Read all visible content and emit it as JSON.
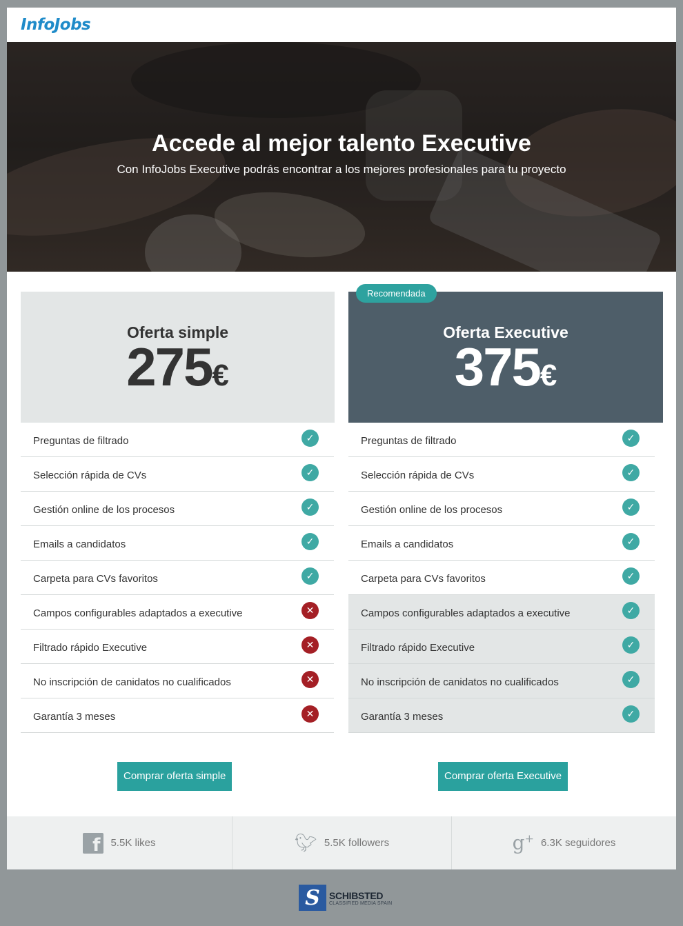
{
  "header": {
    "logo_text": "InfoJobs"
  },
  "hero": {
    "title": "Accede al mejor talento Executive",
    "subtitle": "Con InfoJobs Executive podrás encontrar a los  mejores profesionales para tu proyecto"
  },
  "plans": [
    {
      "name": "Oferta simple",
      "price": "275",
      "currency": "€",
      "button_label": "Comprar oferta simple",
      "features": [
        {
          "label": "Preguntas de filtrado",
          "included": true,
          "icon": "check-icon"
        },
        {
          "label": "Selección rápida de CVs",
          "included": true,
          "icon": "check-icon"
        },
        {
          "label": "Gestión online de los procesos",
          "included": true,
          "icon": "check-icon"
        },
        {
          "label": "Emails a candidatos",
          "included": true,
          "icon": "check-icon"
        },
        {
          "label": "Carpeta para CVs favoritos",
          "included": true,
          "icon": "check-icon"
        },
        {
          "label": "Campos configurables adaptados a executive",
          "included": false,
          "icon": "cross-icon"
        },
        {
          "label": "Filtrado rápido Executive",
          "included": false,
          "icon": "cross-icon"
        },
        {
          "label": "No inscripción de canidatos no cualificados",
          "included": false,
          "icon": "cross-icon"
        },
        {
          "label": "Garantía 3 meses",
          "included": false,
          "icon": "cross-icon"
        }
      ]
    },
    {
      "name": "Oferta Executive",
      "price": "375",
      "currency": "€",
      "badge": "Recomendada",
      "button_label": "Comprar oferta Executive",
      "features": [
        {
          "label": "Preguntas de filtrado",
          "included": true,
          "icon": "check-icon"
        },
        {
          "label": "Selección rápida de CVs",
          "included": true,
          "icon": "check-icon"
        },
        {
          "label": "Gestión online de los procesos",
          "included": true,
          "icon": "check-icon"
        },
        {
          "label": "Emails a candidatos",
          "included": true,
          "icon": "check-icon"
        },
        {
          "label": "Carpeta para CVs favoritos",
          "included": true,
          "icon": "check-icon"
        },
        {
          "label": "Campos configurables adaptados a executive",
          "included": true,
          "icon": "check-icon"
        },
        {
          "label": "Filtrado rápido Executive",
          "included": true,
          "icon": "check-icon"
        },
        {
          "label": "No inscripción de canidatos no cualificados",
          "included": true,
          "icon": "check-icon"
        },
        {
          "label": "Garantía 3 meses",
          "included": true,
          "icon": "check-icon"
        }
      ]
    }
  ],
  "social": [
    {
      "icon": "facebook-icon",
      "text": "5.5K likes"
    },
    {
      "icon": "twitter-icon",
      "text": "5.5K followers"
    },
    {
      "icon": "google-plus-icon",
      "text": "6.3K seguidores"
    }
  ],
  "footer": {
    "brand": "SCHIBSTED",
    "tagline": "CLASSIFIED MEDIA SPAIN"
  },
  "colors": {
    "brand_blue": "#1f8bc9",
    "accent_teal": "#2aa19e",
    "check_teal": "#3fa9a4",
    "cross_red": "#a41f25",
    "executive_header": "#4e5e69",
    "simple_header": "#e3e6e6",
    "page_bg": "#919799"
  }
}
